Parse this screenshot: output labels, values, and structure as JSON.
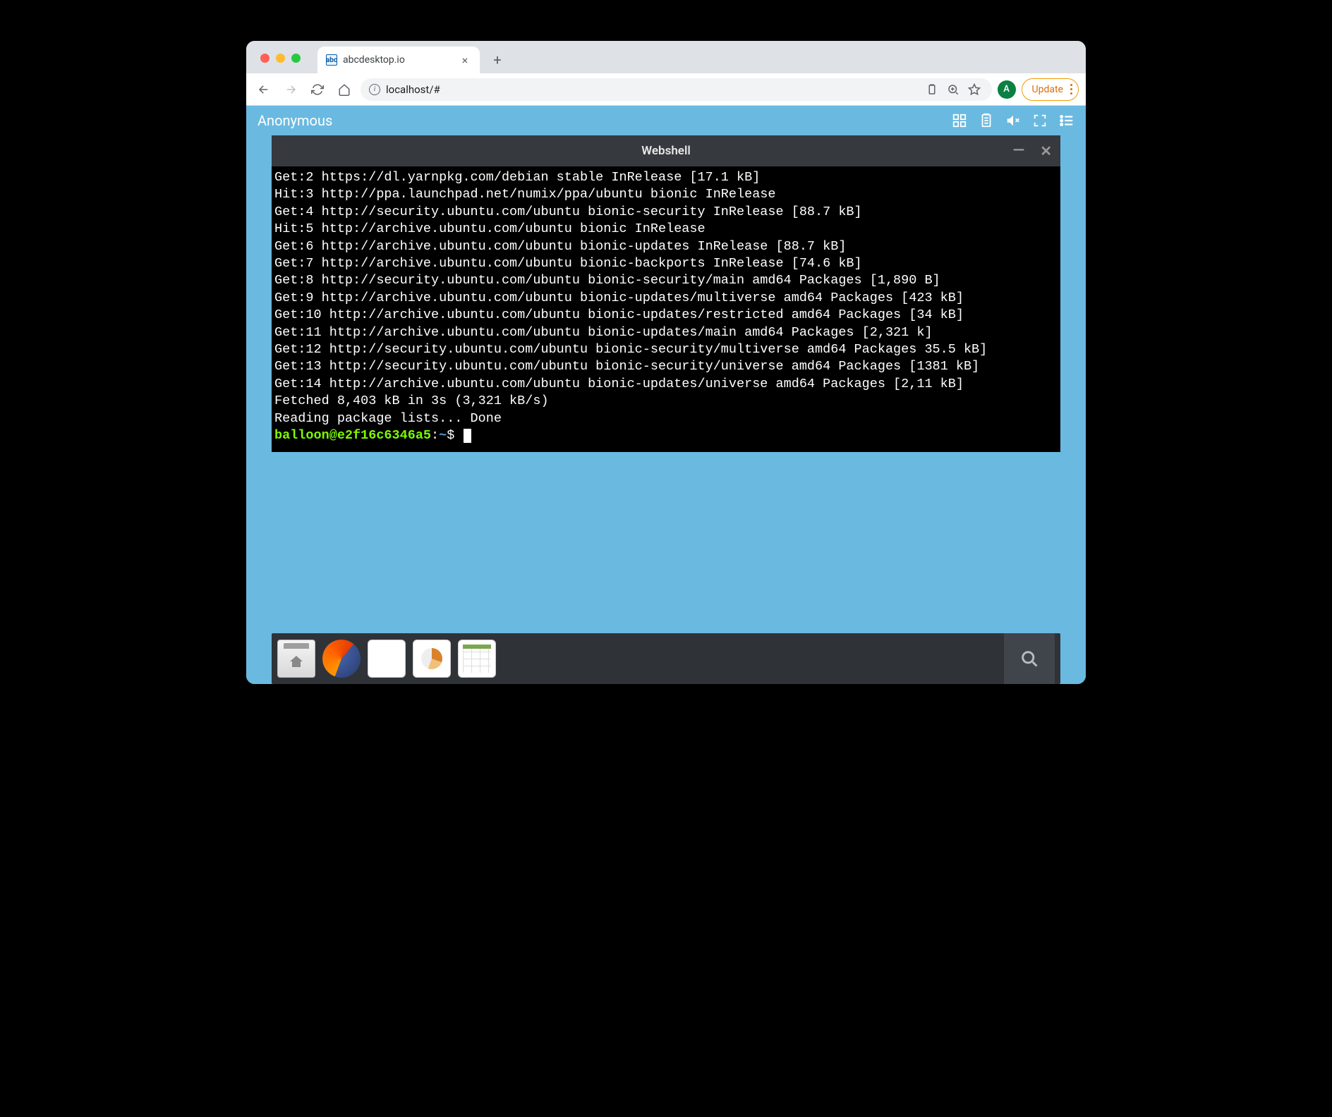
{
  "browser": {
    "tab": {
      "title": "abcdesktop.io",
      "favicon_text": "abc"
    },
    "url": "localhost/#",
    "avatar_letter": "A",
    "update_label": "Update"
  },
  "page": {
    "user_label": "Anonymous"
  },
  "terminal": {
    "title": "Webshell",
    "lines": [
      "Get:2 https://dl.yarnpkg.com/debian stable InRelease [17.1 kB]",
      "Hit:3 http://ppa.launchpad.net/numix/ppa/ubuntu bionic InRelease",
      "Get:4 http://security.ubuntu.com/ubuntu bionic-security InRelease [88.7 kB]",
      "Hit:5 http://archive.ubuntu.com/ubuntu bionic InRelease",
      "Get:6 http://archive.ubuntu.com/ubuntu bionic-updates InRelease [88.7 kB]",
      "Get:7 http://archive.ubuntu.com/ubuntu bionic-backports InRelease [74.6 kB]",
      "Get:8 http://security.ubuntu.com/ubuntu bionic-security/main amd64 Packages [1,890 B]",
      "Get:9 http://archive.ubuntu.com/ubuntu bionic-updates/multiverse amd64 Packages [423 kB]",
      "Get:10 http://archive.ubuntu.com/ubuntu bionic-updates/restricted amd64 Packages [34 kB]",
      "Get:11 http://archive.ubuntu.com/ubuntu bionic-updates/main amd64 Packages [2,321 k]",
      "Get:12 http://security.ubuntu.com/ubuntu bionic-security/multiverse amd64 Packages 35.5 kB]",
      "Get:13 http://security.ubuntu.com/ubuntu bionic-security/universe amd64 Packages [1381 kB]",
      "Get:14 http://archive.ubuntu.com/ubuntu bionic-updates/universe amd64 Packages [2,11 kB]",
      "Fetched 8,403 kB in 3s (3,321 kB/s)",
      "Reading package lists... Done"
    ],
    "prompt": {
      "user": "balloon@e2f16c6346a5",
      "path": "~",
      "symbol": "$"
    }
  },
  "dock": {
    "items": [
      "files",
      "firefox",
      "writer",
      "impress",
      "calc"
    ]
  }
}
